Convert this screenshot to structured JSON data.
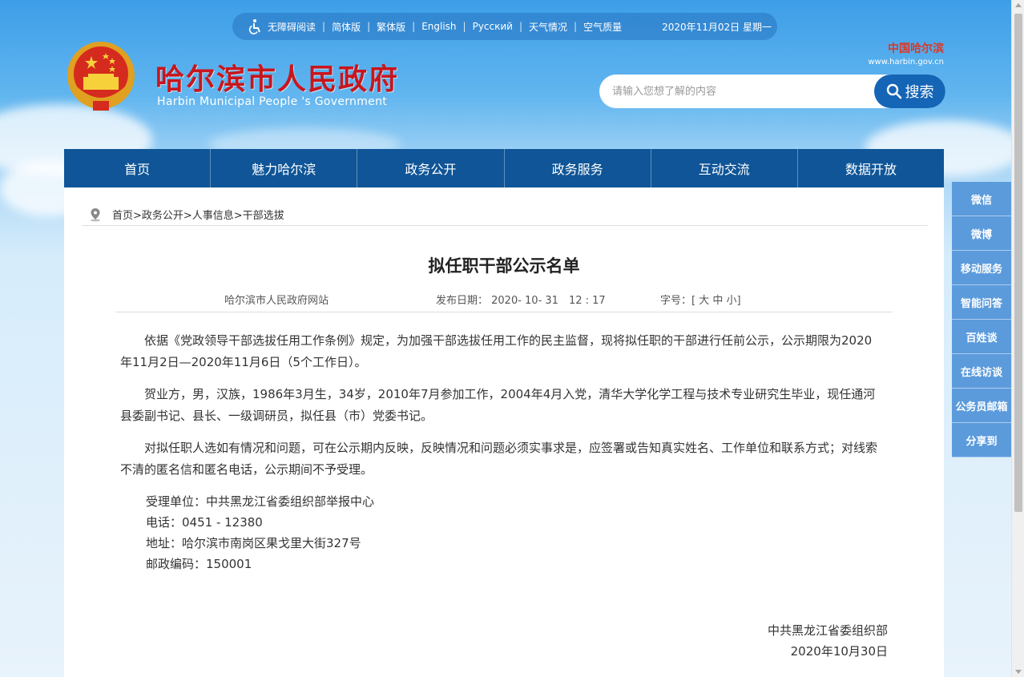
{
  "topbar": {
    "links": [
      "无障碍阅读",
      "简体版",
      "繁体版",
      "English",
      "Русский",
      "天气情况",
      "空气质量"
    ],
    "date": "2020年11月02日 星期一"
  },
  "header": {
    "title": "哈尔滨市人民政府",
    "subtitle": "Harbin Municipal People 's Government",
    "brand_cn": "中国哈尔滨",
    "brand_url": "www.harbin.gov.cn"
  },
  "search": {
    "placeholder": "请输入您想了解的内容",
    "button_label": "搜索"
  },
  "nav": [
    "首页",
    "魅力哈尔滨",
    "政务公开",
    "政务服务",
    "互动交流",
    "数据开放"
  ],
  "breadcrumb": "首页>政务公开>人事信息>干部选拔",
  "article": {
    "title": "拟任职干部公示名单",
    "source": "哈尔滨市人民政府网站",
    "publish_date": "发布日期： 2020- 10- 31　12 : 17",
    "font_size": "字号：[ 大 中 小]",
    "paragraphs": [
      "依据《党政领导干部选拔任用工作条例》规定，为加强干部选拔任用工作的民主监督，现将拟任职的干部进行任前公示，公示期限为2020年11月2日—2020年11月6日（5个工作日）。",
      "贺业方，男，汉族，1986年3月生，34岁，2010年7月参加工作，2004年4月入党，清华大学化学工程与技术专业研究生毕业，现任通河县委副书记、县长、一级调研员，拟任县（市）党委书记。",
      "对拟任职人选如有情况和问题，可在公示期内反映，反映情况和问题必须实事求是，应签署或告知真实姓名、工作单位和联系方式；对线索不清的匿名信和匿名电话，公示期间不予受理。"
    ],
    "contact": {
      "unit": "受理单位：中共黑龙江省委组织部举报中心",
      "phone": "电话：0451 - 12380",
      "address": "地址：哈尔滨市南岗区果戈里大街327号",
      "postcode": "邮政编码：150001"
    },
    "signature": {
      "org": "中共黑龙江省委组织部",
      "date": "2020年10月30日"
    }
  },
  "side": [
    "微信",
    "微博",
    "移动服务",
    "智能问答",
    "百姓谈",
    "在线访谈",
    "公务员邮箱",
    "分享到"
  ],
  "colors": {
    "nav": "#0f5597",
    "title_red": "#c8161d",
    "side": "#5b9bdc"
  }
}
